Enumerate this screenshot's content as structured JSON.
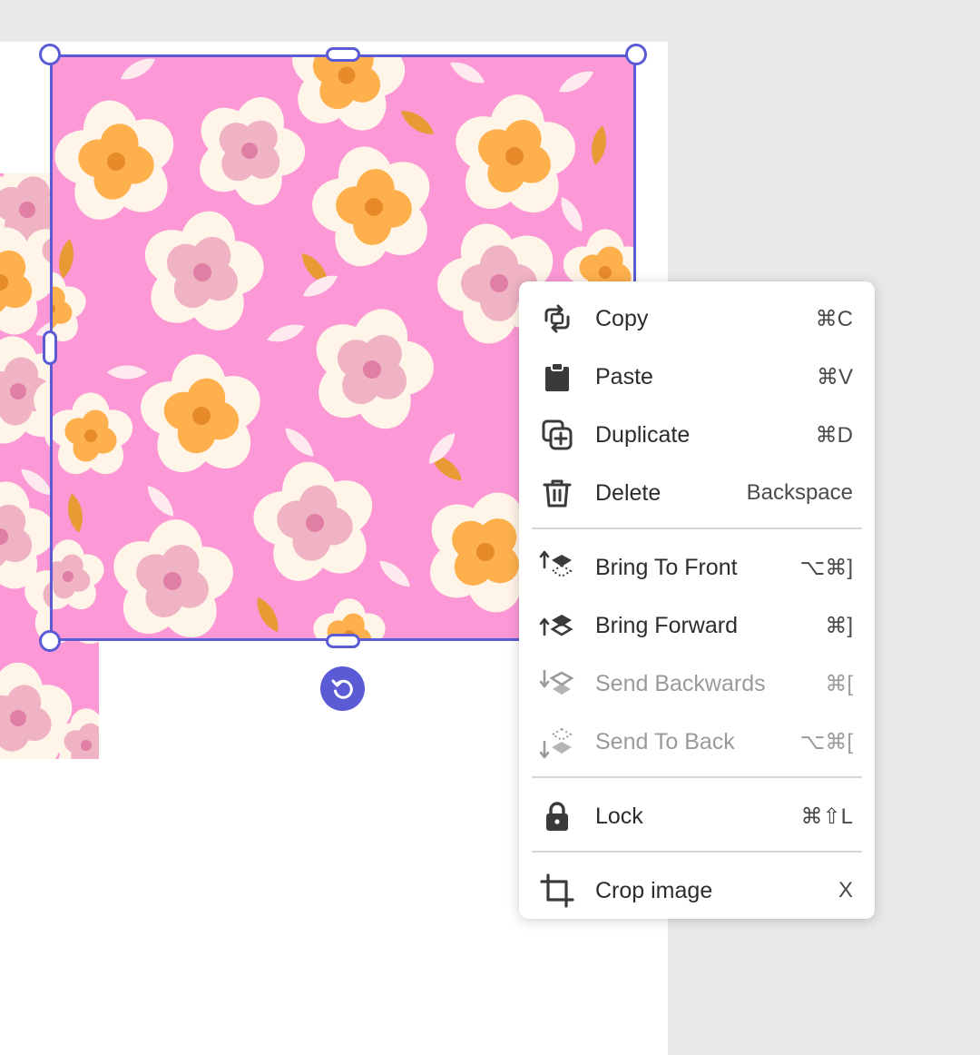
{
  "canvas": {
    "pattern_colors": {
      "background": "#fc98d6",
      "petal_cream": "#fff4e8",
      "flower_orange": "#fdb04c",
      "flower_orange_center": "#e68a2a",
      "flower_pink": "#efb3c4",
      "flower_pink_center": "#e07ea4",
      "leaf_orange": "#e89a35",
      "leaf_cream": "#fde9ee"
    },
    "selection_color": "#5b5bd6"
  },
  "context_menu": {
    "items": [
      {
        "label": "Copy",
        "shortcut": "⌘C",
        "icon": "copy-icon"
      },
      {
        "label": "Paste",
        "shortcut": "⌘V",
        "icon": "clipboard-icon"
      },
      {
        "label": "Duplicate",
        "shortcut": "⌘D",
        "icon": "duplicate-icon"
      },
      {
        "label": "Delete",
        "shortcut": "Backspace",
        "icon": "trash-icon"
      },
      {
        "label": "Bring To Front",
        "shortcut": "⌥⌘]",
        "icon": "bring-to-front-icon"
      },
      {
        "label": "Bring Forward",
        "shortcut": "⌘]",
        "icon": "bring-forward-icon"
      },
      {
        "label": "Send Backwards",
        "shortcut": "⌘[",
        "icon": "send-backwards-icon",
        "disabled": true
      },
      {
        "label": "Send To Back",
        "shortcut": "⌥⌘[",
        "icon": "send-to-back-icon",
        "disabled": true
      },
      {
        "label": "Lock",
        "shortcut": "⌘⇧L",
        "icon": "lock-icon"
      },
      {
        "label": "Crop image",
        "shortcut": "X",
        "icon": "crop-icon"
      }
    ]
  }
}
